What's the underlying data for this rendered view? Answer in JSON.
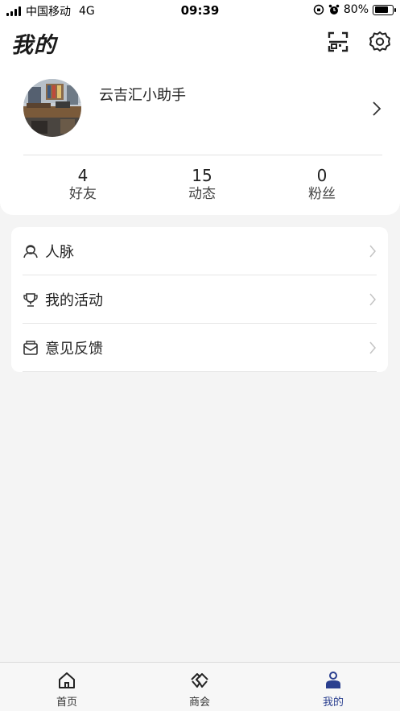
{
  "status_bar": {
    "carrier": "中国移动",
    "network": "4G",
    "time": "09:39",
    "battery": "80%",
    "battery_level": 0.8
  },
  "header": {
    "title": "我的",
    "scan_icon": "scan-icon",
    "settings_icon": "gear-icon"
  },
  "profile": {
    "username": "云吉汇小助手",
    "stats": [
      {
        "value": "4",
        "label": "好友"
      },
      {
        "value": "15",
        "label": "动态"
      },
      {
        "value": "0",
        "label": "粉丝"
      }
    ]
  },
  "menu": [
    {
      "label": "人脉",
      "icon": "contacts-icon"
    },
    {
      "label": "我的活动",
      "icon": "trophy-icon"
    },
    {
      "label": "意见反馈",
      "icon": "feedback-icon"
    }
  ],
  "tabs": [
    {
      "label": "首页",
      "icon": "home-icon",
      "active": false
    },
    {
      "label": "商会",
      "icon": "handshake-icon",
      "active": false
    },
    {
      "label": "我的",
      "icon": "user-icon",
      "active": true
    }
  ],
  "colors": {
    "accent": "#2a3f8f",
    "background": "#f4f4f4"
  }
}
